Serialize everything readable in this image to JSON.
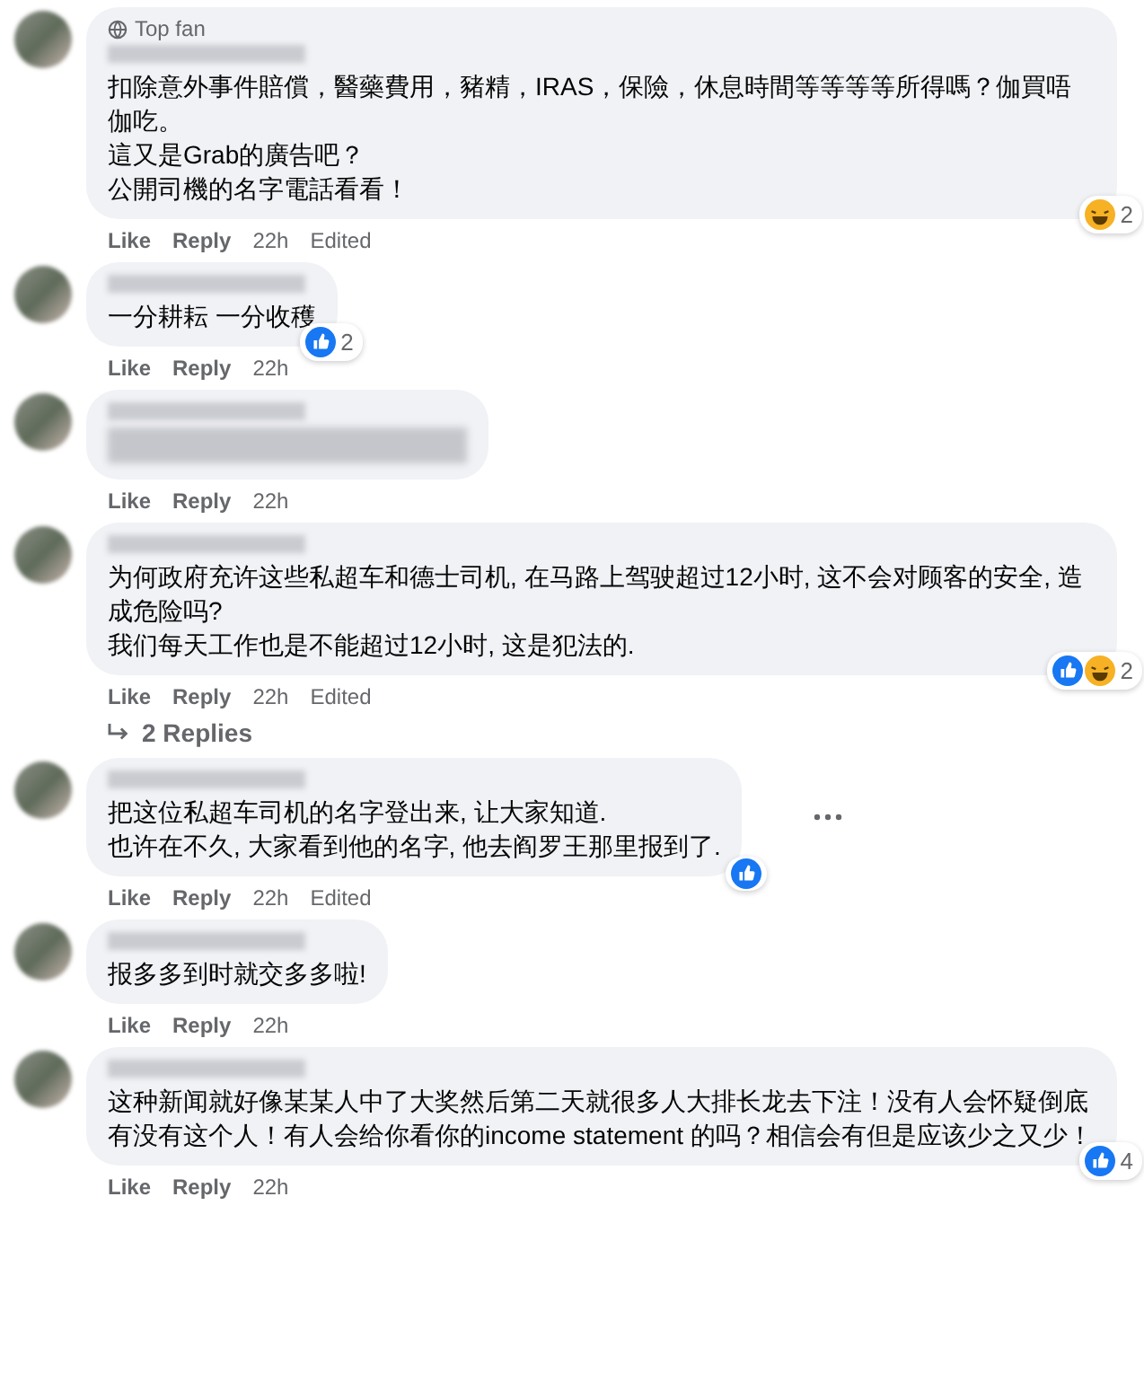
{
  "comments": [
    {
      "badge": "Top fan",
      "lines": [
        "扣除意外事件賠償，醫藥費用，豬精，IRAS，保險，休息時間等等等等所得嗎？伽買唔伽吃。",
        "這又是Grab的廣告吧？",
        "公開司機的名字電話看看！"
      ],
      "reactions": [
        {
          "kind": "haha"
        }
      ],
      "reaction_count": "2",
      "actions": [
        "Like",
        "Reply"
      ],
      "time": "22h",
      "edited": "Edited"
    },
    {
      "lines": [
        "一分耕耘 一分收穫"
      ],
      "reactions": [
        {
          "kind": "like"
        }
      ],
      "reaction_count": "2",
      "actions": [
        "Like",
        "Reply"
      ],
      "time": "22h"
    },
    {
      "body_blurred": true,
      "actions": [
        "Like",
        "Reply"
      ],
      "time": "22h"
    },
    {
      "lines": [
        "为何政府充许这些私超车和德士司机, 在马路上驾驶超过12小时, 这不会对顾客的安全, 造成危险吗?",
        "我们每天工作也是不能超过12小时, 这是犯法的."
      ],
      "reactions": [
        {
          "kind": "like"
        },
        {
          "kind": "haha"
        }
      ],
      "reaction_count": "2",
      "actions": [
        "Like",
        "Reply"
      ],
      "time": "22h",
      "edited": "Edited",
      "replies": "2 Replies"
    },
    {
      "lines": [
        "把这位私超车司机的名字登出来, 让大家知道.",
        "也许在不久, 大家看到他的名字, 他去阎罗王那里报到了."
      ],
      "reactions": [
        {
          "kind": "like"
        }
      ],
      "actions": [
        "Like",
        "Reply"
      ],
      "time": "22h",
      "edited": "Edited",
      "more": true
    },
    {
      "lines": [
        "报多多到时就交多多啦!"
      ],
      "actions": [
        "Like",
        "Reply"
      ],
      "time": "22h"
    },
    {
      "lines": [
        "这种新闻就好像某某人中了大奖然后第二天就很多人大排长龙去下注！没有人会怀疑倒底有没有这个人！有人会给你看你的income statement 的吗？相信会有但是应该少之又少！"
      ],
      "reactions": [
        {
          "kind": "like"
        }
      ],
      "reaction_count": "4",
      "actions": [
        "Like",
        "Reply"
      ],
      "time": "22h"
    }
  ]
}
